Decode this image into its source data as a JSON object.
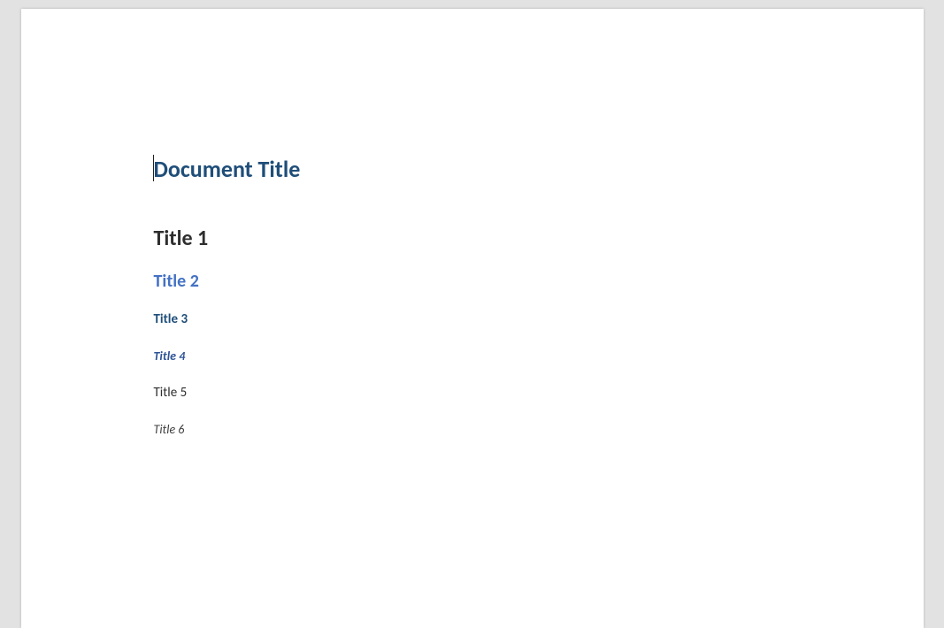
{
  "document": {
    "title": "Document Title",
    "headings": {
      "h1": "Title 1",
      "h2": "Title 2",
      "h3": "Title 3",
      "h4": "Title 4",
      "h5": "Title 5",
      "h6": "Title 6"
    }
  }
}
